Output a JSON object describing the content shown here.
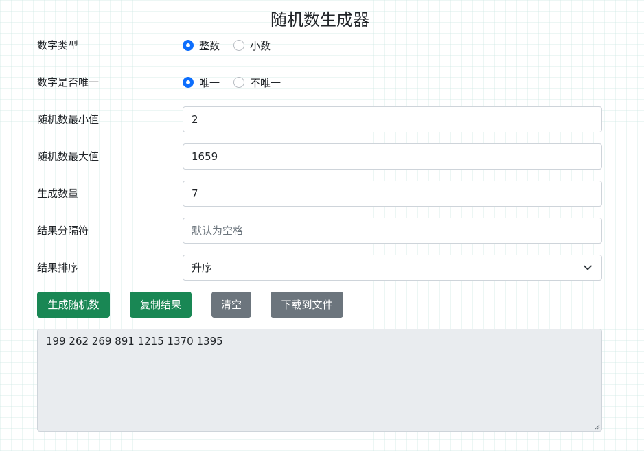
{
  "title": "随机数生成器",
  "number_type": {
    "label": "数字类型",
    "options": [
      {
        "label": "整数",
        "checked": true
      },
      {
        "label": "小数",
        "checked": false
      }
    ]
  },
  "unique": {
    "label": "数字是否唯一",
    "options": [
      {
        "label": "唯一",
        "checked": true
      },
      {
        "label": "不唯一",
        "checked": false
      }
    ]
  },
  "min": {
    "label": "随机数最小值",
    "value": "2"
  },
  "max": {
    "label": "随机数最大值",
    "value": "1659"
  },
  "count": {
    "label": "生成数量",
    "value": "7"
  },
  "separator": {
    "label": "结果分隔符",
    "value": "",
    "placeholder": "默认为空格"
  },
  "sort": {
    "label": "结果排序",
    "selected": "升序"
  },
  "buttons": {
    "generate": "生成随机数",
    "copy": "复制结果",
    "clear": "清空",
    "download": "下载到文件"
  },
  "result": {
    "text": "199 262 269 891 1215 1370 1395"
  },
  "colors": {
    "primary": "#0d6efd",
    "success": "#198754",
    "secondary": "#6c757d",
    "readonly_bg": "#e9ecef"
  }
}
